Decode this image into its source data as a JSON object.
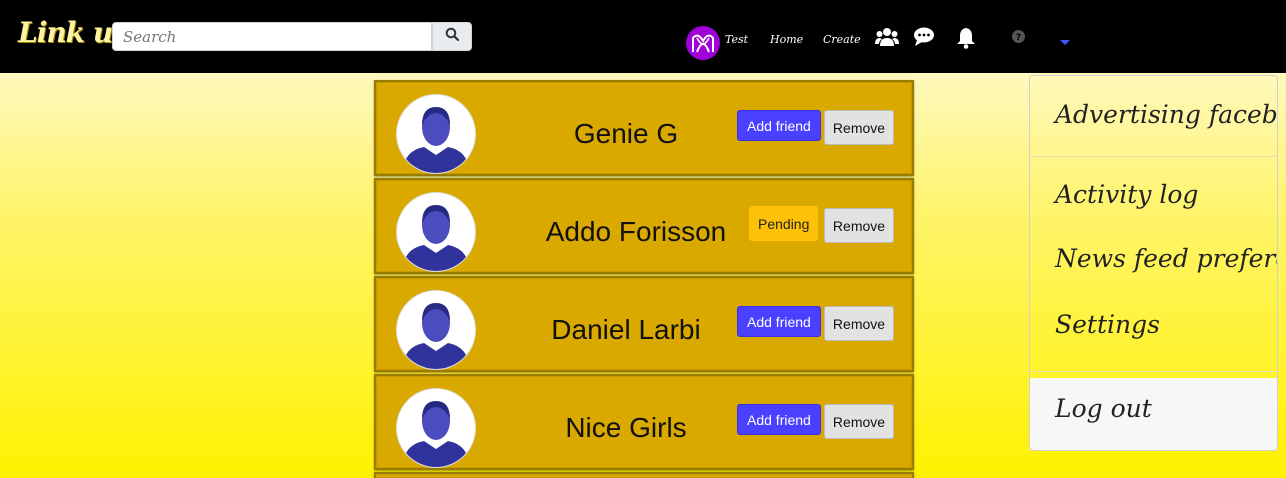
{
  "header": {
    "logo": "Link up",
    "search_placeholder": "Search",
    "nav": {
      "profile_label": "Test",
      "home_label": "Home",
      "create_label": "Create"
    },
    "icons": [
      "users-icon",
      "chat-icon",
      "bell-icon",
      "help-icon",
      "caret-down-icon"
    ]
  },
  "friends": [
    {
      "name": "Genie G",
      "status": "Add friend",
      "remove": "Remove"
    },
    {
      "name": "Addo Forisson",
      "status": "Pending",
      "remove": "Remove"
    },
    {
      "name": "Daniel Larbi",
      "status": "Add friend",
      "remove": "Remove"
    },
    {
      "name": "Nice Girls",
      "status": "Add friend",
      "remove": "Remove"
    }
  ],
  "dropdown": {
    "items": [
      "Advertising facebook",
      "Activity log",
      "News feed preferences",
      "Settings",
      "Log out"
    ]
  },
  "colors": {
    "topbar": "#000000",
    "card": "#daa900",
    "add_button": "#4a40ff",
    "pending_button": "#ffc107",
    "avatar_accent": "#a000d8"
  }
}
